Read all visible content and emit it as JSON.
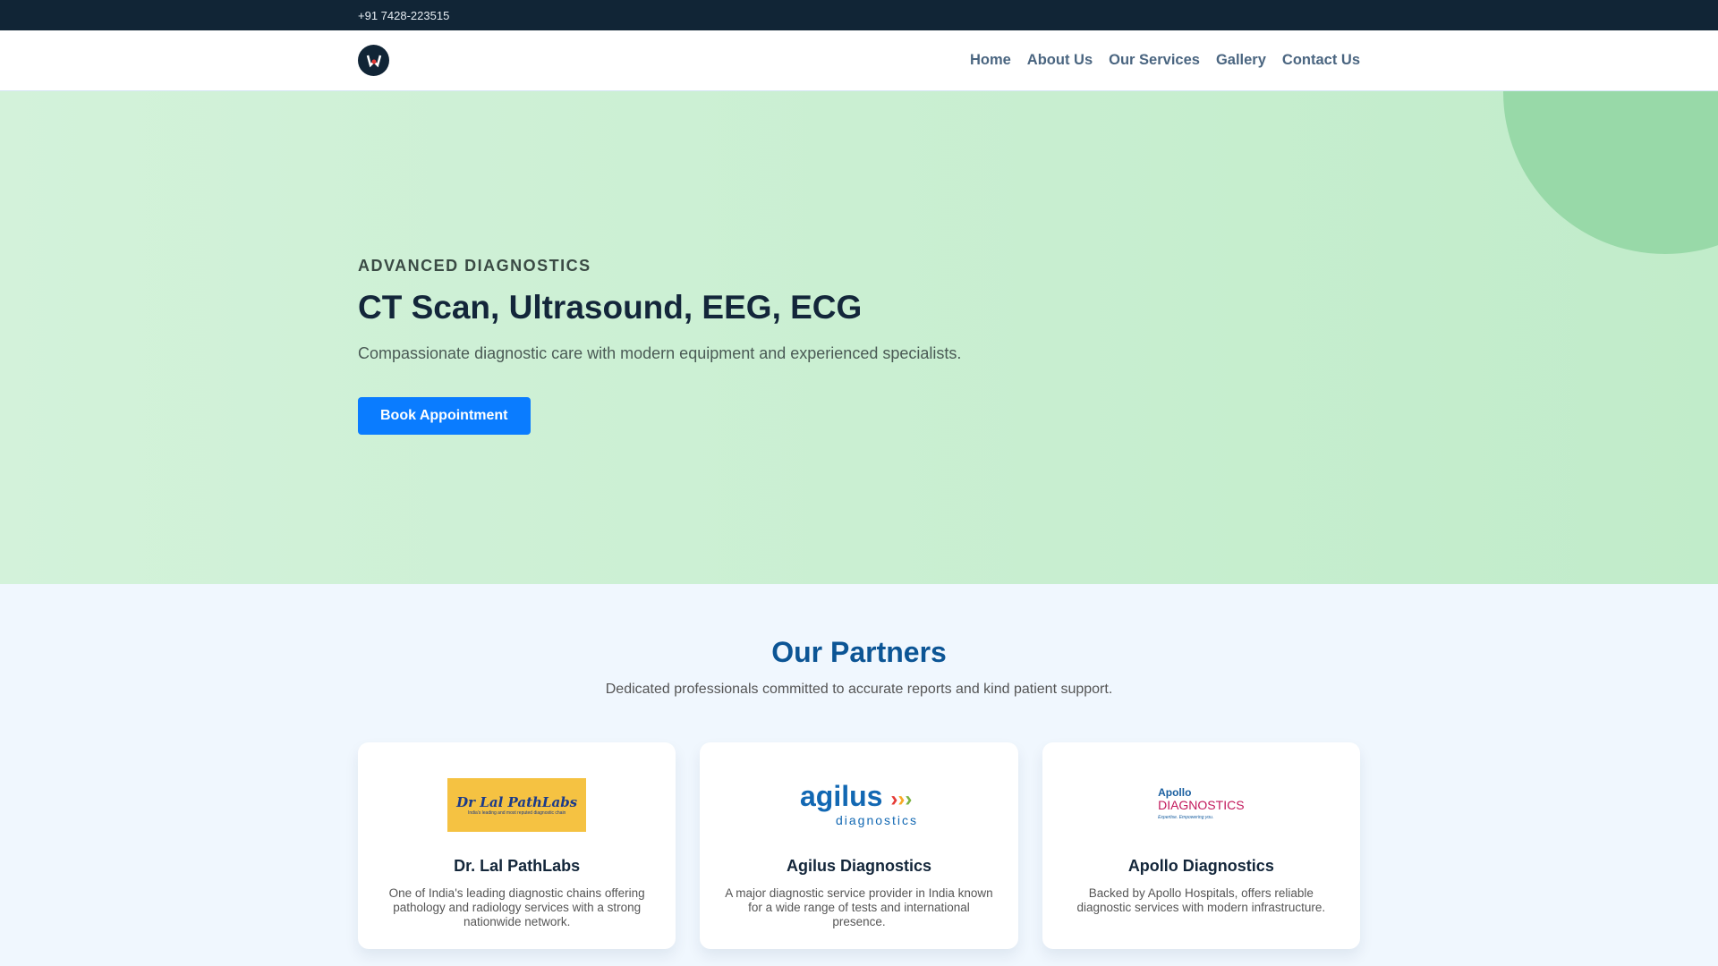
{
  "topbar": {
    "phone": "+91 7428-223515"
  },
  "nav": {
    "links": [
      "Home",
      "About Us",
      "Our Services",
      "Gallery",
      "Contact Us"
    ]
  },
  "hero": {
    "eyebrow": "ADVANCED DIAGNOSTICS",
    "title": "CT Scan, Ultrasound, EEG, ECG",
    "subtitle": "Compassionate diagnostic care with modern equipment and experienced specialists.",
    "cta": "Book Appointment"
  },
  "partners": {
    "title": "Our Partners",
    "subtitle": "Dedicated professionals committed to accurate reports and kind patient support.",
    "items": [
      {
        "name": "Dr. Lal PathLabs",
        "desc": "One of India's leading diagnostic chains offering pathology and radiology services with a strong nationwide network.",
        "logo_text": "Dr Lal PathLabs",
        "logo_tagline": "India's leading and most reputed diagnostic chain"
      },
      {
        "name": "Agilus Diagnostics",
        "desc": "A major diagnostic service provider in India known for a wide range of tests and international presence.",
        "logo_text": "agilus",
        "logo_tagline": "diagnostics"
      },
      {
        "name": "Apollo Diagnostics",
        "desc": "Backed by Apollo Hospitals, offers reliable diagnostic services with modern infrastructure.",
        "logo_text": "Apollo DIAGNOSTICS",
        "logo_tagline": "Expertise. Empowering you."
      }
    ]
  }
}
